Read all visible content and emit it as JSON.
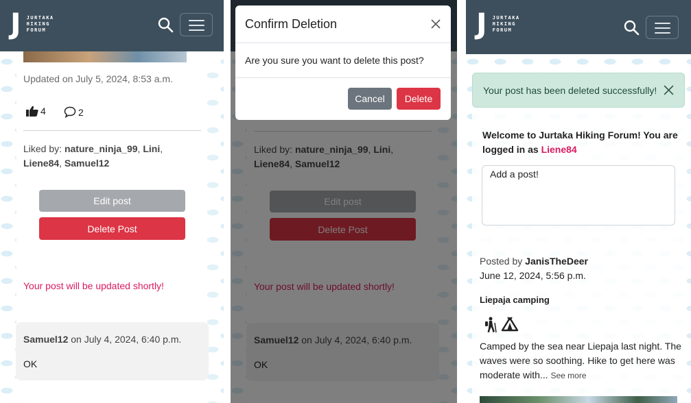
{
  "brand": {
    "letter": "J",
    "line1": "JURTAKA",
    "line2": "HIKING",
    "line3": "FORUM"
  },
  "icons": {
    "search": "search-icon",
    "menu": "hamburger-menu-icon",
    "like": "thumbs-up-icon",
    "comment": "comment-icon",
    "close": "close-icon",
    "hiker": "hiker-icon",
    "tent": "tent-icon"
  },
  "colors": {
    "navbar": "#3d4f5c",
    "danger": "#dc3545",
    "secondary": "#a5a9ad",
    "accent": "#d81b60",
    "success_bg": "#cfe8de"
  },
  "post_detail": {
    "updated": "Updated on July 5, 2024, 8:53 a.m.",
    "like_count": "4",
    "comment_count": "2",
    "liked_by_label": "Liked by:",
    "liked_by_users": [
      "nature_ninja_99",
      "Lini",
      "Liene84",
      "Samuel12"
    ],
    "edit_button": "Edit post",
    "delete_button": "Delete Post",
    "pending_message": "Your post will be updated shortly!",
    "comment": {
      "author": "Samuel12",
      "date": "on July 4, 2024, 6:40 p.m.",
      "text": "OK"
    }
  },
  "modal": {
    "title": "Confirm Deletion",
    "body": "Are you sure you want to delete this post?",
    "cancel": "Cancel",
    "delete": "Delete"
  },
  "home": {
    "alert": "Your post has been deleted successfully!",
    "welcome": "Welcome to Jurtaka Hiking Forum! You are logged in as",
    "welcome_line1": "Welcome to Jurtaka Hiking Forum! You are",
    "welcome_line2": "logged in as",
    "username": "Liene84",
    "textarea_placeholder": "Add a post!",
    "post": {
      "posted_by_label": "Posted by",
      "author": "JanisTheDeer",
      "date": "June 12, 2024, 5:56 p.m.",
      "title": "Liepaja camping",
      "excerpt_line1": "Camped by the sea near Liepaja last night. The",
      "excerpt_line2": "waves were so soothing. Hike to get here was",
      "excerpt_line3": "moderate with...",
      "see_more": "See more"
    }
  }
}
